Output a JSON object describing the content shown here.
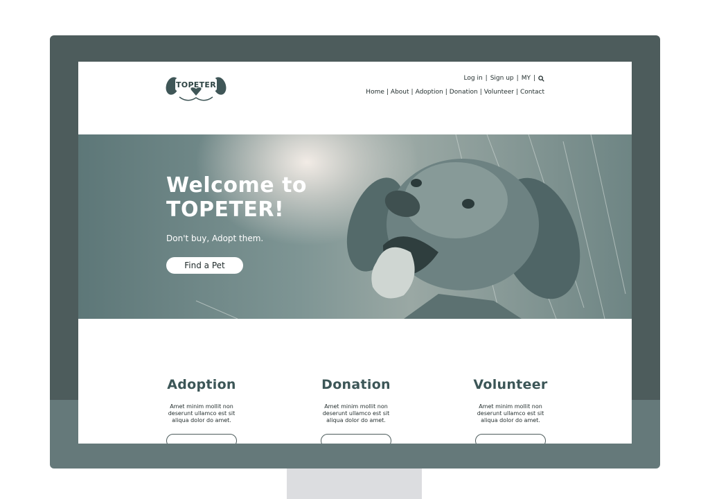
{
  "brand": {
    "logo_text": "TOPETER"
  },
  "header": {
    "top_links": [
      "Log in",
      "Sign up",
      "MY"
    ],
    "nav": [
      "Home",
      "About",
      "Adoption",
      "Donation",
      "Volunteer",
      "Contact"
    ]
  },
  "hero": {
    "title": "Welcome to TOPETER!",
    "subtitle": "Don't buy, Adopt them.",
    "cta_label": "Find a Pet"
  },
  "features": [
    {
      "title": "Adoption",
      "text": "Amet minim mollit non deserunt ullamco est sit aliqua dolor do amet."
    },
    {
      "title": "Donation",
      "text": "Amet minim mollit non deserunt ullamco est sit aliqua dolor do amet."
    },
    {
      "title": "Volunteer",
      "text": "Amet minim mollit non deserunt ullamco est sit aliqua dolor do amet."
    }
  ],
  "colors": {
    "monitor_frame": "#4d5c5c",
    "monitor_chin": "#65797a",
    "accent": "#3c5657"
  },
  "icons": {
    "search": "search-icon"
  }
}
